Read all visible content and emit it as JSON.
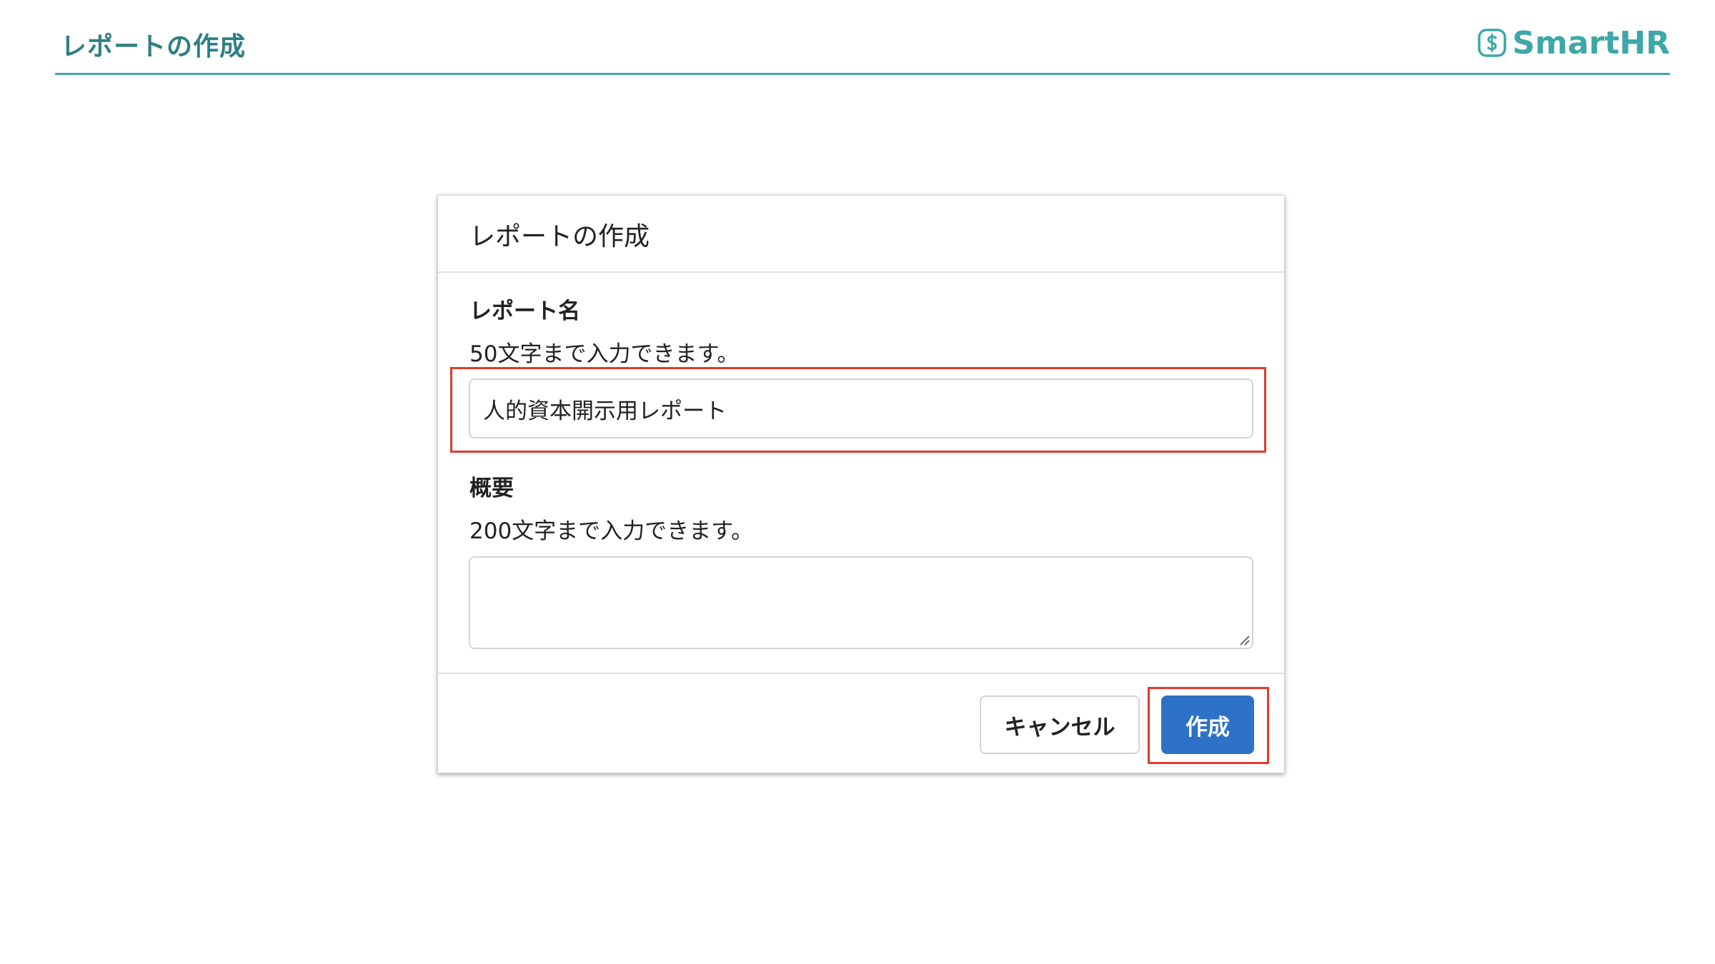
{
  "header": {
    "title": "レポートの作成",
    "logo_text": "SmartHR",
    "logo_icon": "smarthr-logo-icon",
    "accent_color": "#3ea7a8"
  },
  "dialog": {
    "title": "レポートの作成",
    "report_name": {
      "label": "レポート名",
      "help": "50文字まで入力できます。",
      "value": "人的資本開示用レポート"
    },
    "summary": {
      "label": "概要",
      "help": "200文字まで入力できます。",
      "value": ""
    },
    "footer": {
      "cancel_label": "キャンセル",
      "create_label": "作成"
    }
  },
  "colors": {
    "primary_button": "#2e72c8",
    "highlight": "#e03a2f"
  }
}
